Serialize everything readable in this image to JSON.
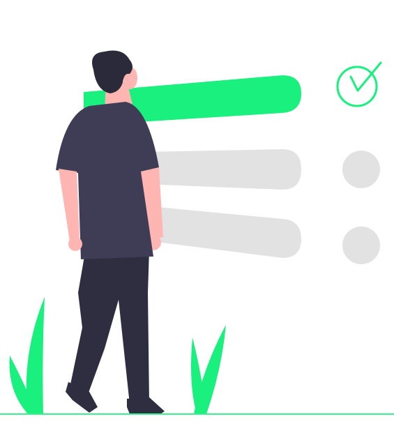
{
  "illustration": {
    "theme": "checklist",
    "items": [
      {
        "state": "checked",
        "bar_color": "#19F07E",
        "marker": "check-circle-icon"
      },
      {
        "state": "pending",
        "bar_color": "#E2E2E2",
        "marker": "circle-icon"
      },
      {
        "state": "pending",
        "bar_color": "#E2E2E2",
        "marker": "circle-icon"
      }
    ],
    "colors": {
      "accent": "#19F07E",
      "inactive": "#E2E2E2",
      "hair": "#2B2A3A",
      "shirt": "#3F3D56",
      "pants": "#2F2E41",
      "skin": "#FFB6B3",
      "shoes": "#2F2E41",
      "ground": "#3AF08B"
    }
  }
}
